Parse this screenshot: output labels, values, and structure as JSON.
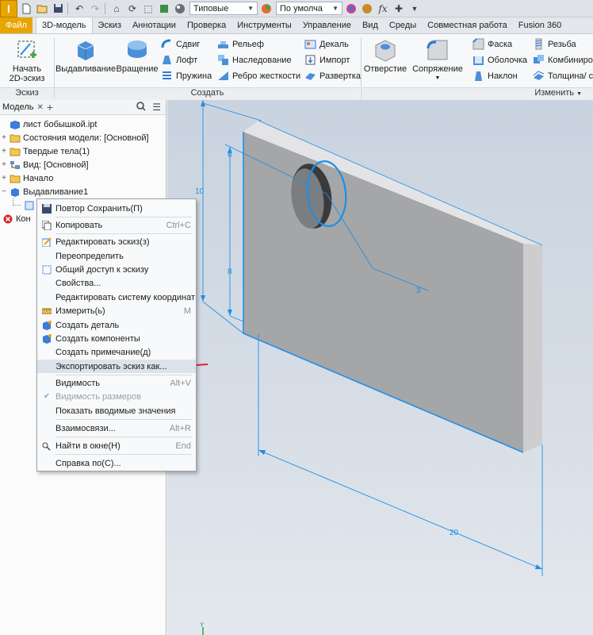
{
  "qat": {
    "logo": "I",
    "style_combo": "Типовые",
    "appearance_combo": "По умолча",
    "fx_label": "fx"
  },
  "tabs": [
    "Файл",
    "3D-модель",
    "Эскиз",
    "Аннотации",
    "Проверка",
    "Инструменты",
    "Управление",
    "Вид",
    "Среды",
    "Совместная работа",
    "Fusion 360"
  ],
  "ribbon": {
    "sketch_btn": "Начать\n2D-эскиз",
    "sketch_line1": "Начать",
    "sketch_line2": "2D-эскиз",
    "extrude": "Выдавливание",
    "revolve": "Вращение",
    "sweep": "Сдвиг",
    "loft": "Лофт",
    "coil": "Пружина",
    "emboss": "Рельеф",
    "derive": "Наследование",
    "rib": "Ребро жесткости",
    "decal": "Декаль",
    "import": "Импорт",
    "unwrap": "Развертка",
    "hole": "Отверстие",
    "fillet": "Сопряжение",
    "chamfer": "Фаска",
    "shell": "Оболочка",
    "draft": "Наклон",
    "thread": "Резьба",
    "combine": "Комбиниро",
    "thicken": "Толщина/ с",
    "panel_sketch": "Эскиз",
    "panel_create": "Создать",
    "panel_modify": "Изменить"
  },
  "browser": {
    "tab": "Модель",
    "items": [
      {
        "label": "лист бобышкой.ipt",
        "twisty": ""
      },
      {
        "label": "Состояния модели: [Основной]",
        "twisty": "+"
      },
      {
        "label": "Твердые тела(1)",
        "twisty": "+"
      },
      {
        "label": "Вид: [Основной]",
        "twisty": "+"
      },
      {
        "label": "Начало",
        "twisty": "+"
      },
      {
        "label": "Выдавливание1",
        "twisty": "−"
      },
      {
        "label": "Кон",
        "twisty": ""
      }
    ]
  },
  "menu": {
    "items": [
      {
        "label": "Повтор Сохранить(П)",
        "shortcut": ""
      },
      {
        "label": "Копировать",
        "shortcut": "Ctrl+C"
      },
      {
        "label": "Редактировать эскиз(з)",
        "shortcut": ""
      },
      {
        "label": "Переопределить",
        "shortcut": ""
      },
      {
        "label": "Общий доступ к эскизу",
        "shortcut": ""
      },
      {
        "label": "Свойства...",
        "shortcut": ""
      },
      {
        "label": "Редактировать систему координат",
        "shortcut": ""
      },
      {
        "label": "Измерить(ь)",
        "shortcut": "M"
      },
      {
        "label": "Создать деталь",
        "shortcut": ""
      },
      {
        "label": "Создать компоненты",
        "shortcut": ""
      },
      {
        "label": "Создать примечание(д)",
        "shortcut": ""
      },
      {
        "label": "Экспортировать эскиз как...",
        "shortcut": ""
      },
      {
        "label": "Видимость",
        "shortcut": "Alt+V"
      },
      {
        "label": "Видимость размеров",
        "shortcut": ""
      },
      {
        "label": "Показать вводимые значения",
        "shortcut": ""
      },
      {
        "label": "Взаимосвязи...",
        "shortcut": "Alt+R"
      },
      {
        "label": "Найти в окне(Н)",
        "shortcut": "End"
      },
      {
        "label": "Справка по(С)...",
        "shortcut": ""
      }
    ]
  },
  "dimensions": {
    "d10": "10",
    "d6": "6",
    "d8": "8",
    "d3": "3",
    "d20": "20"
  },
  "colors": {
    "accent": "#e8a400",
    "sketch_blue": "#1e8fe6",
    "annotation_red": "#e0202a"
  }
}
